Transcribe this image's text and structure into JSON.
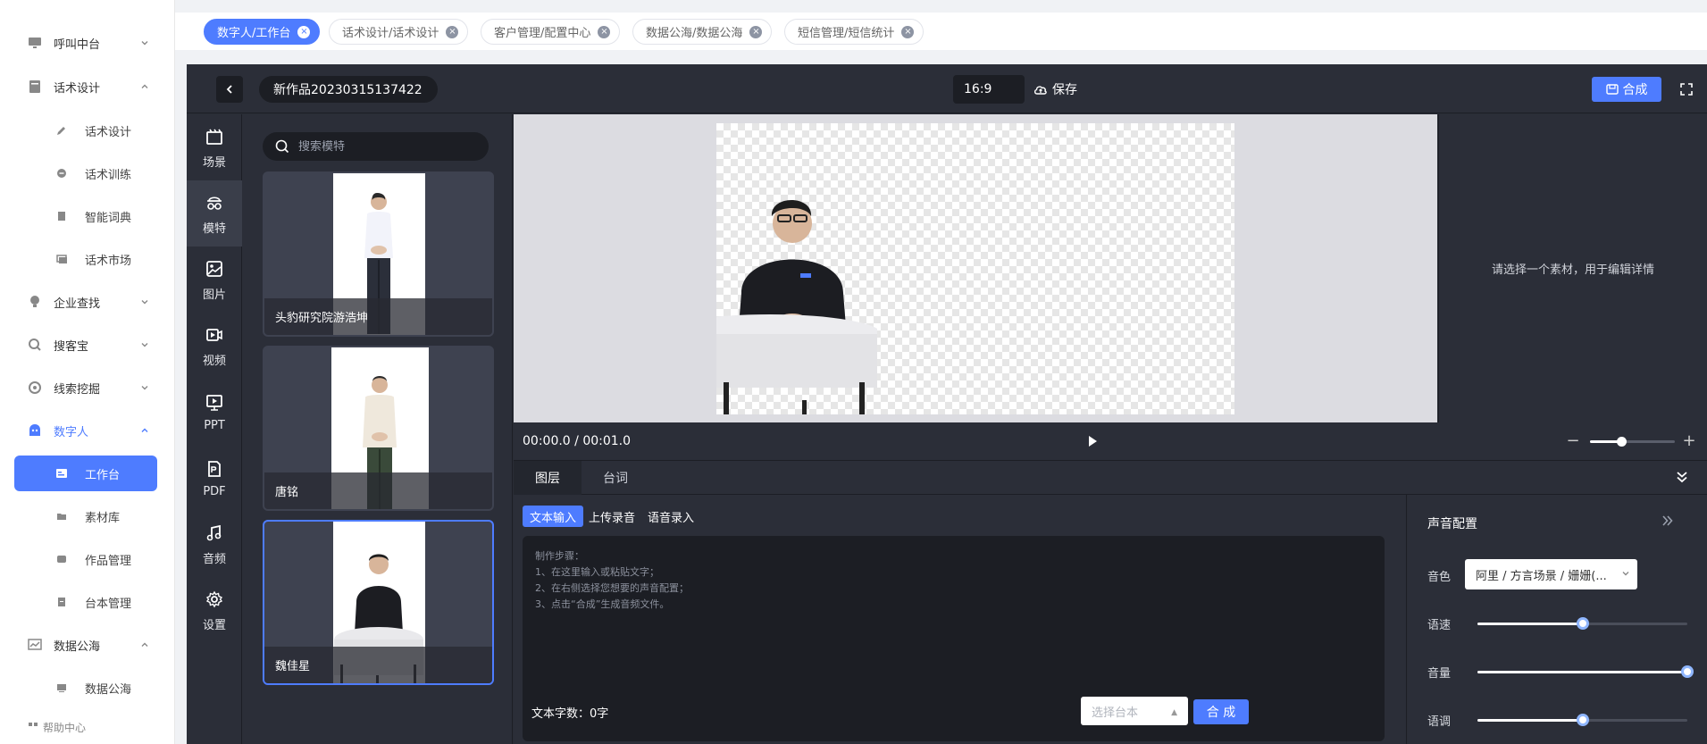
{
  "nav": {
    "items": [
      {
        "label": "呼叫中台",
        "icon": "monitor-icon",
        "expanded": false
      },
      {
        "label": "话术设计",
        "icon": "book-icon",
        "expanded": true
      },
      {
        "label": "话术设计",
        "icon": "edit-icon",
        "sub": true
      },
      {
        "label": "话术训练",
        "icon": "chat-icon",
        "sub": true
      },
      {
        "label": "智能词典",
        "icon": "dictionary-icon",
        "sub": true
      },
      {
        "label": "话术市场",
        "icon": "market-icon",
        "sub": true
      },
      {
        "label": "企业查找",
        "icon": "bulb-icon",
        "expanded": false
      },
      {
        "label": "搜客宝",
        "icon": "search-icon",
        "expanded": false
      },
      {
        "label": "线索挖掘",
        "icon": "target-icon",
        "expanded": false
      },
      {
        "label": "数字人",
        "icon": "robot-icon",
        "expanded": true
      },
      {
        "label": "工作台",
        "icon": "workbench-icon",
        "sub": true,
        "active": true
      },
      {
        "label": "素材库",
        "icon": "folder-icon",
        "sub": true
      },
      {
        "label": "作品管理",
        "icon": "works-icon",
        "sub": true
      },
      {
        "label": "台本管理",
        "icon": "script-icon",
        "sub": true
      },
      {
        "label": "数据公海",
        "icon": "chart-icon",
        "expanded": true
      },
      {
        "label": "数据公海",
        "icon": "data-icon",
        "sub": true
      },
      {
        "label": "帮助中心",
        "icon": "help-icon"
      }
    ]
  },
  "tabs": [
    {
      "label": "数字人/工作台",
      "active": true
    },
    {
      "label": "话术设计/话术设计"
    },
    {
      "label": "客户管理/配置中心"
    },
    {
      "label": "数据公海/数据公海"
    },
    {
      "label": "短信管理/短信统计"
    }
  ],
  "editor": {
    "title": "新作品20230315137422",
    "ratio": "16:9",
    "save_label": "保存",
    "synth_label": "合成"
  },
  "tools": [
    {
      "label": "场景",
      "icon": "scene-icon"
    },
    {
      "label": "模特",
      "icon": "model-icon",
      "active": true
    },
    {
      "label": "图片",
      "icon": "image-icon"
    },
    {
      "label": "视频",
      "icon": "video-icon"
    },
    {
      "label": "PPT",
      "icon": "ppt-icon"
    },
    {
      "label": "PDF",
      "icon": "pdf-icon"
    },
    {
      "label": "音频",
      "icon": "music-icon"
    },
    {
      "label": "设置",
      "icon": "settings-icon"
    }
  ],
  "models": {
    "search_placeholder": "搜索模特",
    "cards": [
      {
        "name": "头豹研究院游浩坤"
      },
      {
        "name": "唐铭"
      },
      {
        "name": "魏佳星",
        "selected": true
      }
    ]
  },
  "inspector": {
    "hint": "请选择一个素材，用于编辑详情"
  },
  "timeline": {
    "time": "00:00.0 / 00:01.0",
    "zoom_fraction": 0.37
  },
  "bottom_tabs": [
    {
      "label": "图层",
      "active": true
    },
    {
      "label": "台词"
    }
  ],
  "text_input": {
    "modes": [
      {
        "label": "文本输入",
        "active": true
      },
      {
        "label": "上传录音"
      },
      {
        "label": "语音录入"
      }
    ],
    "placeholder": "制作步骤：\n1、在这里输入或粘贴文字；\n2、在右侧选择您想要的声音配置；\n3、点击“合成”生成音频文件。",
    "word_count": "文本字数：0字",
    "script_placeholder": "选择台本",
    "synth_label": "合 成"
  },
  "voice": {
    "title": "声音配置",
    "timbre_label": "音色",
    "timbre_value": "阿里 / 方言场景 / 姗姗(...",
    "speed_label": "语速",
    "speed_value": 0.5,
    "volume_label": "音量",
    "volume_value": 1.0,
    "pitch_label": "语调",
    "pitch_value": 0.5
  },
  "colors": {
    "accent": "#4e7cff",
    "editor_bg": "#2b2e38"
  }
}
